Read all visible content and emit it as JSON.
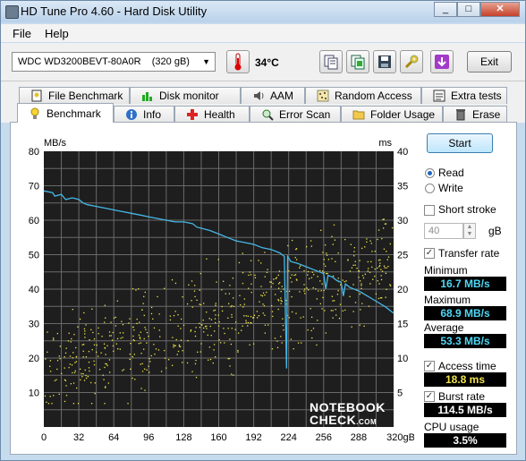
{
  "window": {
    "title": "HD Tune Pro 4.60 - Hard Disk Utility"
  },
  "menu": {
    "file": "File",
    "help": "Help"
  },
  "toolbar": {
    "drive": "WDC WD3200BEVT-80A0R    (320 gB)",
    "temperature": "34°C",
    "exit_label": "Exit"
  },
  "tabs_row1": [
    "File Benchmark",
    "Disk monitor",
    "AAM",
    "Random Access",
    "Extra tests"
  ],
  "tabs_row2": [
    "Benchmark",
    "Info",
    "Health",
    "Error Scan",
    "Folder Usage",
    "Erase"
  ],
  "side": {
    "start_label": "Start",
    "read_label": "Read",
    "write_label": "Write",
    "short_stroke_label": "Short stroke",
    "short_stroke_value": "40",
    "gb_unit": "gB",
    "transfer_rate_label": "Transfer rate",
    "minimum_label": "Minimum",
    "minimum_value": "16.7 MB/s",
    "maximum_label": "Maximum",
    "maximum_value": "68.9 MB/s",
    "average_label": "Average",
    "average_value": "53.3 MB/s",
    "access_time_label": "Access time",
    "access_time_value": "18.8 ms",
    "burst_rate_label": "Burst rate",
    "burst_rate_value": "114.5 MB/s",
    "cpu_usage_label": "CPU usage",
    "cpu_usage_value": "3.5%"
  },
  "watermark": {
    "line1": "NOTEBOOK",
    "line2": "CHECK",
    "suffix": ".COM"
  },
  "colors": {
    "transfer_line": "#45b8e8",
    "access_dots": "#f0e84a",
    "chart_bg": "#1e1e1e",
    "grid": "#6a6a6a"
  },
  "chart_data": {
    "type": "line",
    "ylabel": "MB/s",
    "y2label": "ms",
    "xunit": "gB",
    "xlim": [
      0,
      320
    ],
    "ylim": [
      0,
      80
    ],
    "y2lim": [
      0,
      40
    ],
    "x_ticks": [
      0,
      32,
      64,
      96,
      128,
      160,
      192,
      224,
      256,
      288,
      320
    ],
    "y_ticks": [
      10,
      20,
      30,
      40,
      50,
      60,
      70,
      80
    ],
    "y2_ticks": [
      5,
      10,
      15,
      20,
      25,
      30,
      35,
      40
    ],
    "grid": true,
    "series": [
      {
        "name": "Transfer rate",
        "x": [
          0,
          8,
          10,
          16,
          20,
          26,
          32,
          36,
          40,
          48,
          56,
          64,
          72,
          80,
          88,
          96,
          104,
          112,
          120,
          128,
          136,
          140,
          152,
          160,
          168,
          176,
          184,
          192,
          200,
          208,
          216,
          220,
          222,
          223,
          224,
          226,
          232,
          240,
          248,
          256,
          258,
          260,
          264,
          268,
          272,
          274,
          276,
          280,
          288,
          296,
          304,
          312,
          320
        ],
        "y": [
          68.5,
          68,
          67,
          67.5,
          66,
          66.5,
          66,
          65,
          64.5,
          64,
          63.5,
          63,
          62.5,
          62,
          61.5,
          61,
          60.5,
          60,
          59.5,
          59.5,
          59,
          58,
          57,
          56,
          55,
          54,
          53.5,
          53,
          52,
          51.5,
          50.5,
          49.5,
          17,
          49.5,
          49,
          48,
          47.5,
          46.5,
          45.5,
          44.5,
          40,
          44,
          43.5,
          42.5,
          42,
          38,
          41.5,
          40.5,
          39.5,
          38,
          36.5,
          35,
          33
        ]
      }
    ],
    "access_time_ms_scatter": "random accesses spread between ~4 ms and ~28 ms"
  }
}
